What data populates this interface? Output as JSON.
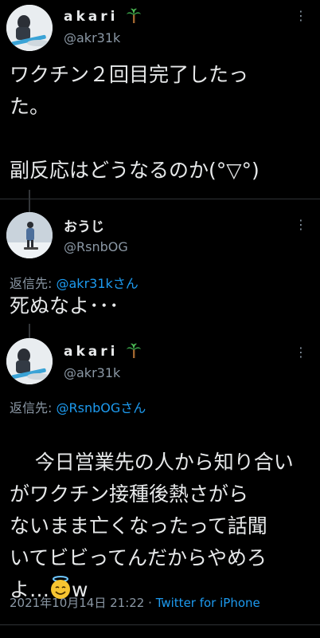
{
  "tweets": [
    {
      "display_name": "akari",
      "name_emoji": "palm-tree",
      "handle": "@akr31k",
      "text": "ワクチン２回目完了したっ\nた。\n\n副反応はどうなるのか(°▽°)"
    },
    {
      "display_name": "おうじ",
      "handle": "@RsnbOG",
      "reply_label": "返信先:",
      "reply_to": "@akr31kさん",
      "text": "死ぬなよ･･･"
    },
    {
      "display_name": "akari",
      "name_emoji": "palm-tree",
      "handle": "@akr31k",
      "reply_label": "返信先:",
      "reply_to": "@RsnbOGさん",
      "text_main": "今日営業先の人から知り合い\nがワクチン接種後熱さがら\nないまま亡くなったって話聞\nいてビビってんだからやめろ\nよ…",
      "text_tail": "w",
      "text_emoji": "smiling-face-with-halo",
      "timestamp": "2021年10月14日 21:22",
      "separator": "·",
      "source": "Twitter for iPhone"
    }
  ]
}
